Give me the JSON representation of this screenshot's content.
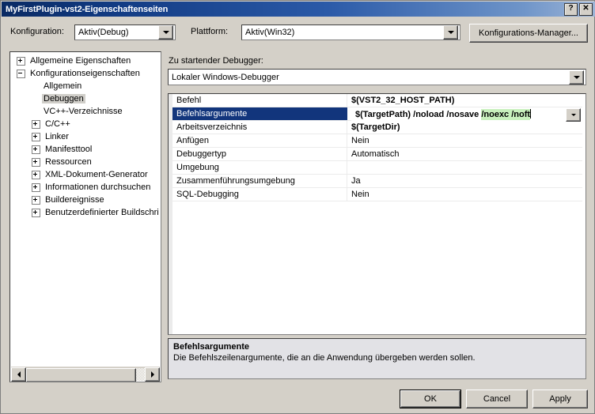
{
  "window": {
    "title": "MyFirstPlugin-vst2-Eigenschaftenseiten",
    "help_button": "?",
    "close_button": "✕"
  },
  "toolbar": {
    "configuration_label": "Konfiguration:",
    "configuration_value": "Aktiv(Debug)",
    "platform_label": "Plattform:",
    "platform_value": "Aktiv(Win32)",
    "config_manager_button": "Konfigurations-Manager..."
  },
  "tree": {
    "items": [
      {
        "label": "Allgemeine Eigenschaften",
        "indent": 0,
        "expander": "plus",
        "selected": false
      },
      {
        "label": "Konfigurationseigenschaften",
        "indent": 0,
        "expander": "minus",
        "selected": false
      },
      {
        "label": "Allgemein",
        "indent": 1,
        "expander": "none",
        "selected": false
      },
      {
        "label": "Debuggen",
        "indent": 1,
        "expander": "none",
        "selected": true
      },
      {
        "label": "VC++-Verzeichnisse",
        "indent": 1,
        "expander": "none",
        "selected": false
      },
      {
        "label": "C/C++",
        "indent": 1,
        "expander": "plus",
        "selected": false
      },
      {
        "label": "Linker",
        "indent": 1,
        "expander": "plus",
        "selected": false
      },
      {
        "label": "Manifesttool",
        "indent": 1,
        "expander": "plus",
        "selected": false
      },
      {
        "label": "Ressourcen",
        "indent": 1,
        "expander": "plus",
        "selected": false
      },
      {
        "label": "XML-Dokument-Generator",
        "indent": 1,
        "expander": "plus",
        "selected": false
      },
      {
        "label": "Informationen durchsuchen",
        "indent": 1,
        "expander": "plus",
        "selected": false
      },
      {
        "label": "Buildereignisse",
        "indent": 1,
        "expander": "plus",
        "selected": false
      },
      {
        "label": "Benutzerdefinierter Buildschri",
        "indent": 1,
        "expander": "plus",
        "selected": false
      }
    ]
  },
  "debugger": {
    "label": "Zu startender Debugger:",
    "value": "Lokaler Windows-Debugger"
  },
  "grid": {
    "rows": [
      {
        "name": "Befehl",
        "value": "$(VST2_32_HOST_PATH)",
        "bold": true,
        "selected": false,
        "editing": false
      },
      {
        "name": "Befehlsargumente",
        "value": "$(TargetPath) /noload /nosave ",
        "bold": true,
        "selected": true,
        "editing": true,
        "selected_text": "/noexc /noft"
      },
      {
        "name": "Arbeitsverzeichnis",
        "value": "$(TargetDir)",
        "bold": true,
        "selected": false,
        "editing": false
      },
      {
        "name": "Anfügen",
        "value": "Nein",
        "bold": false,
        "selected": false,
        "editing": false
      },
      {
        "name": "Debuggertyp",
        "value": "Automatisch",
        "bold": false,
        "selected": false,
        "editing": false
      },
      {
        "name": "Umgebung",
        "value": "",
        "bold": false,
        "selected": false,
        "editing": false
      },
      {
        "name": "Zusammenführungsumgebung",
        "value": "Ja",
        "bold": false,
        "selected": false,
        "editing": false
      },
      {
        "name": "SQL-Debugging",
        "value": "Nein",
        "bold": false,
        "selected": false,
        "editing": false
      }
    ]
  },
  "description": {
    "title": "Befehlsargumente",
    "body": "Die Befehlszeilenargumente, die an die Anwendung übergeben werden sollen."
  },
  "footer": {
    "ok": "OK",
    "cancel": "Cancel",
    "apply": "Apply"
  },
  "colors": {
    "title_bar_start": "#0a2a63",
    "title_bar_end": "#9db4d6",
    "dialog_face": "#d4d0c8",
    "row_selected": "#12357c",
    "text_selection_highlight": "#c8f0bd",
    "tree_selected": "#d0cec9",
    "description_panel": "#e2e2e6"
  }
}
